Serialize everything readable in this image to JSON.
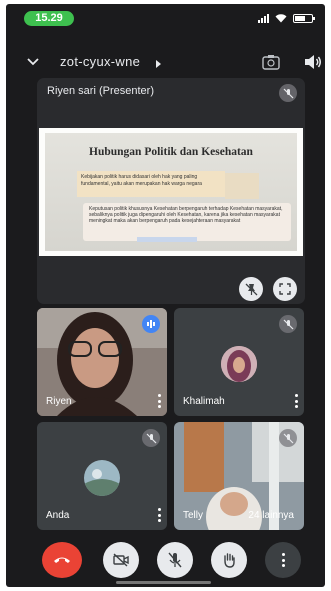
{
  "status_bar": {
    "time": "15.29"
  },
  "header": {
    "meeting_code": "zot-cyux-wne"
  },
  "presenter": {
    "name": "Riyen sari (Presenter)",
    "slide": {
      "title": "Hubungan Politik dan Kesehatan",
      "text1": "Kebijakan politik harus didasari oleh hak yang paling fundamental, yaitu akan merupakan hak warga negara",
      "text2": "Keputusan politik khususnya Kesehatan berpengaruh terhadap Kesehatan masyarakat, sebaliknya politik juga dipengaruhi oleh Kesehatan, karena jika kesehatan masyarakat meningkat maka akan berpengaruh pada kesejahteraan masyarakat"
    }
  },
  "participants": [
    {
      "name": "Riyen",
      "speaking": true
    },
    {
      "name": "Khalimah",
      "muted": true
    },
    {
      "name": "Anda",
      "muted": true
    },
    {
      "name": "Telly",
      "muted": true
    }
  ],
  "more_participants": "24 lainnya",
  "colors": {
    "end_call": "#ea4335",
    "tile_bg": "#3c4043",
    "speaking_badge": "#4285f4"
  }
}
